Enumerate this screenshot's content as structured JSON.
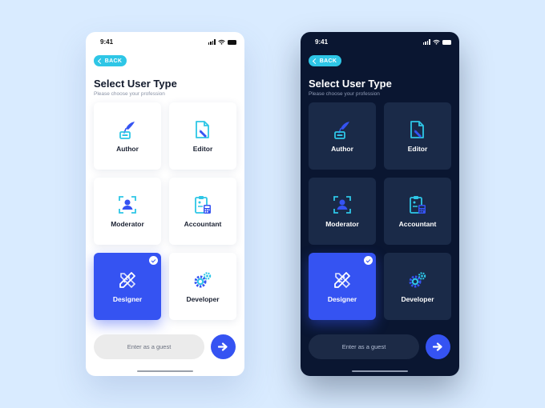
{
  "screens": [
    {
      "theme": "light",
      "status": {
        "time": "9:41"
      },
      "back_label": "BACK",
      "title": "Select User Type",
      "subtitle": "Please choose your profession",
      "options": [
        {
          "label": "Author",
          "icon": "quill-pen-icon",
          "selected": false
        },
        {
          "label": "Editor",
          "icon": "document-edit-icon",
          "selected": false
        },
        {
          "label": "Moderator",
          "icon": "user-focus-icon",
          "selected": false
        },
        {
          "label": "Accountant",
          "icon": "clipboard-calculator-icon",
          "selected": false
        },
        {
          "label": "Designer",
          "icon": "pencil-ruler-icon",
          "selected": true
        },
        {
          "label": "Developer",
          "icon": "gears-icon",
          "selected": false
        }
      ],
      "guest_label": "Enter as a guest"
    },
    {
      "theme": "dark",
      "status": {
        "time": "9:41"
      },
      "back_label": "BACK",
      "title": "Select User Type",
      "subtitle": "Please choose your profession",
      "options": [
        {
          "label": "Author",
          "icon": "quill-pen-icon",
          "selected": false
        },
        {
          "label": "Editor",
          "icon": "document-edit-icon",
          "selected": false
        },
        {
          "label": "Moderator",
          "icon": "user-focus-icon",
          "selected": false
        },
        {
          "label": "Accountant",
          "icon": "clipboard-calculator-icon",
          "selected": false
        },
        {
          "label": "Designer",
          "icon": "pencil-ruler-icon",
          "selected": true
        },
        {
          "label": "Developer",
          "icon": "gears-icon",
          "selected": false
        }
      ],
      "guest_label": "Enter as a guest"
    }
  ],
  "colors": {
    "page_background": "#d9ebff",
    "accent_blue": "#3553f2",
    "accent_cyan": "#2ec6e6",
    "dark_background": "#0a1631",
    "dark_card": "#1a2a48"
  }
}
